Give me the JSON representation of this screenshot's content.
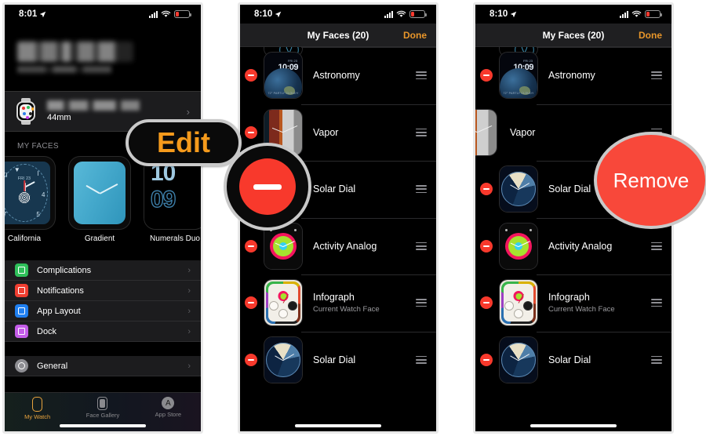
{
  "panels": [
    {
      "id": "my-watch",
      "statusbar": {
        "time": "8:01",
        "location_icon": "location-arrow-icon",
        "signal_icon": "cellular-signal-icon",
        "wifi_icon": "wifi-icon",
        "battery_icon": "battery-low-icon"
      },
      "account": {
        "name_redacted": true
      },
      "device": {
        "name_redacted": true,
        "subtitle": "44mm",
        "chevron": "›",
        "icon": "apple-watch-icon"
      },
      "section_header": "MY FACES",
      "faces": [
        {
          "label": "California"
        },
        {
          "label": "Gradient"
        },
        {
          "label": "Numerals Duo",
          "time_top": "10",
          "time_bottom": "09"
        }
      ],
      "menu": [
        {
          "label": "Complications",
          "icon": "complications-icon",
          "color": "#2fc05a",
          "chevron": "›"
        },
        {
          "label": "Notifications",
          "icon": "notifications-icon",
          "color": "#f03e31",
          "chevron": "›"
        },
        {
          "label": "App Layout",
          "icon": "app-layout-icon",
          "color": "#1f7ff0",
          "chevron": "›"
        },
        {
          "label": "Dock",
          "icon": "dock-icon",
          "color": "#c45ce8",
          "chevron": "›"
        }
      ],
      "menu2": [
        {
          "label": "General",
          "icon": "gear-icon",
          "color": "#8e8e93",
          "chevron": "›"
        }
      ],
      "tabs": [
        {
          "label": "My Watch",
          "icon": "watch-tab-icon",
          "active": true
        },
        {
          "label": "Face Gallery",
          "icon": "face-gallery-tab-icon",
          "active": false
        },
        {
          "label": "App Store",
          "icon": "app-store-tab-icon",
          "active": false
        }
      ]
    },
    {
      "id": "my-faces-edit",
      "statusbar": {
        "time": "8:10"
      },
      "nav": {
        "title": "My Faces (20)",
        "done": "Done"
      },
      "rows": [
        {
          "name": "",
          "subtitle": "",
          "art": "breathe",
          "partial": true
        },
        {
          "name": "Astronomy",
          "subtitle": "",
          "art": "astro",
          "astro_time": "10:09",
          "astro_date": "FRI 23",
          "astro_weather": "72° PARTLY CLOUDY"
        },
        {
          "name": "Vapor",
          "subtitle": "",
          "art": "vapor"
        },
        {
          "name": "Solar Dial",
          "subtitle": "",
          "art": "solar"
        },
        {
          "name": "Activity Analog",
          "subtitle": "",
          "art": "activity"
        },
        {
          "name": "Infograph",
          "subtitle": "Current Watch Face",
          "art": "info"
        },
        {
          "name": "Solar Dial",
          "subtitle": "",
          "art": "solar"
        }
      ]
    },
    {
      "id": "my-faces-swiped",
      "statusbar": {
        "time": "8:10"
      },
      "nav": {
        "title": "My Faces (20)",
        "done": "Done"
      },
      "rows": [
        {
          "name": "",
          "subtitle": "",
          "art": "breathe",
          "partial": true
        },
        {
          "name": "Astronomy",
          "subtitle": "",
          "art": "astro",
          "astro_time": "10:09",
          "astro_date": "FRI 23",
          "astro_weather": "72° PARTLY CLOUDY"
        },
        {
          "name": "Vapor",
          "subtitle": "",
          "art": "vapor",
          "swiped": true
        },
        {
          "name": "Solar Dial",
          "subtitle": "",
          "art": "solar"
        },
        {
          "name": "Activity Analog",
          "subtitle": "",
          "art": "activity"
        },
        {
          "name": "Infograph",
          "subtitle": "Current Watch Face",
          "art": "info"
        },
        {
          "name": "Solar Dial",
          "subtitle": "",
          "art": "solar"
        }
      ]
    }
  ],
  "callouts": {
    "edit": {
      "label": "Edit",
      "text_color": "#f59a1c"
    },
    "minus": {
      "label": "",
      "icon": "minus-circle-icon",
      "color": "#f8392c"
    },
    "remove": {
      "label": "Remove",
      "color": "#f8483a",
      "text_color": "#ffffff"
    }
  }
}
